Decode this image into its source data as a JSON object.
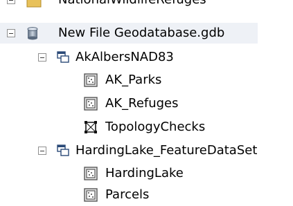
{
  "tree": {
    "partial_item": {
      "label": "NationalWildlifeRefuges"
    },
    "geodatabase": {
      "label": "New File Geodatabase.gdb"
    },
    "datasets": [
      {
        "label": "AkAlbersNAD83",
        "children": [
          {
            "label": "AK_Parks",
            "icon": "feature-class-icon"
          },
          {
            "label": "AK_Refuges",
            "icon": "feature-class-icon"
          },
          {
            "label": "TopologyChecks",
            "icon": "topology-icon"
          }
        ]
      },
      {
        "label": "HardingLake_FeatureDataSet",
        "children": [
          {
            "label": "HardingLake",
            "icon": "feature-class-icon"
          },
          {
            "label": "Parcels",
            "icon": "feature-class-icon"
          }
        ]
      }
    ]
  }
}
